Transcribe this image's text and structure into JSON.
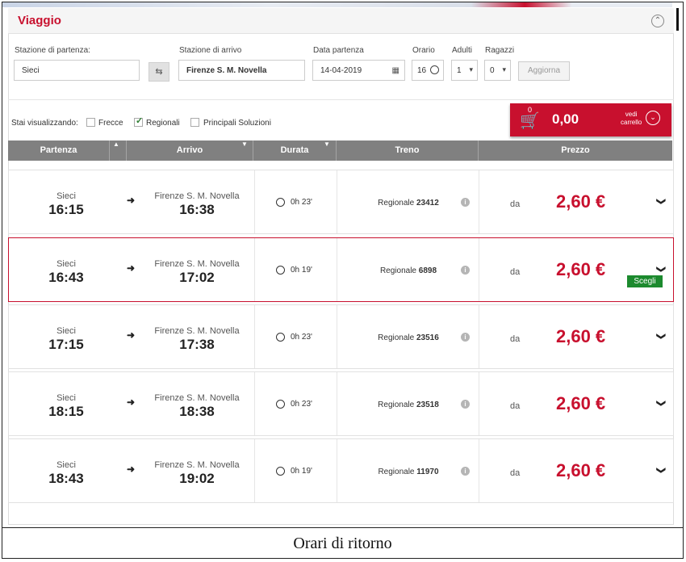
{
  "header": {
    "title": "Viaggio",
    "collapse_icon": "chevron-up-icon"
  },
  "search": {
    "departure_label": "Stazione di partenza:",
    "departure_value": "Sieci",
    "arrival_label": "Stazione di arrivo",
    "arrival_value": "Firenze S. M. Novella",
    "date_label": "Data partenza",
    "date_value": "14-04-2019",
    "time_label": "Orario",
    "time_value": "16",
    "adults_label": "Adulti",
    "adults_value": "1",
    "kids_label": "Ragazzi",
    "kids_value": "0",
    "update_label": "Aggiorna"
  },
  "filters": {
    "label": "Stai visualizzando:",
    "options": [
      {
        "label": "Frecce",
        "checked": false
      },
      {
        "label": "Regionali",
        "checked": true
      },
      {
        "label": "Principali Soluzioni",
        "checked": false
      }
    ]
  },
  "cart": {
    "badge": "0",
    "amount": "0,00",
    "link_line1": "vedi",
    "link_line2": "carrello"
  },
  "columns": {
    "departure": "Partenza",
    "arrival": "Arrivo",
    "duration": "Durata",
    "train": "Treno",
    "price": "Prezzo"
  },
  "rows": [
    {
      "dep_station": "Sieci",
      "dep_time": "16:15",
      "arr_station": "Firenze S. M. Novella",
      "arr_time": "16:38",
      "duration": "0h 23'",
      "train_type": "Regionale",
      "train_num": "23412",
      "price_prefix": "da",
      "price": "2,60 €"
    },
    {
      "dep_station": "Sieci",
      "dep_time": "16:43",
      "arr_station": "Firenze S. M. Novella",
      "arr_time": "17:02",
      "duration": "0h 19'",
      "train_type": "Regionale",
      "train_num": "6898",
      "price_prefix": "da",
      "price": "2,60 €",
      "choose_label": "Scegli"
    },
    {
      "dep_station": "Sieci",
      "dep_time": "17:15",
      "arr_station": "Firenze S. M. Novella",
      "arr_time": "17:38",
      "duration": "0h 23'",
      "train_type": "Regionale",
      "train_num": "23516",
      "price_prefix": "da",
      "price": "2,60 €"
    },
    {
      "dep_station": "Sieci",
      "dep_time": "18:15",
      "arr_station": "Firenze S. M. Novella",
      "arr_time": "18:38",
      "duration": "0h 23'",
      "train_type": "Regionale",
      "train_num": "23518",
      "price_prefix": "da",
      "price": "2,60 €"
    },
    {
      "dep_station": "Sieci",
      "dep_time": "18:43",
      "arr_station": "Firenze S. M. Novella",
      "arr_time": "19:02",
      "duration": "0h 19'",
      "train_type": "Regionale",
      "train_num": "11970",
      "price_prefix": "da",
      "price": "2,60 €"
    }
  ],
  "caption": "Orari di ritorno",
  "colors": {
    "brand_red": "#c8102e",
    "header_gray": "#808080",
    "choose_green": "#1c8a2e"
  }
}
